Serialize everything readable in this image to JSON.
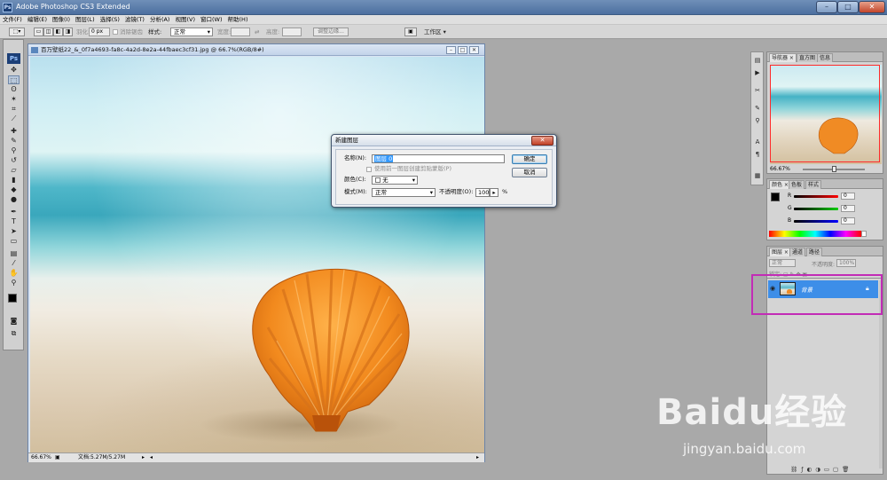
{
  "app": {
    "title": "Adobe Photoshop CS3 Extended",
    "logo": "Ps"
  },
  "window_controls": {
    "minimize": "–",
    "maximize": "□",
    "close": "✕"
  },
  "menu": [
    "文件(F)",
    "编辑(E)",
    "图像(I)",
    "图层(L)",
    "选择(S)",
    "滤镜(T)",
    "分析(A)",
    "视图(V)",
    "窗口(W)",
    "帮助(H)"
  ],
  "options": {
    "feather_label": "羽化:",
    "feather_value": "0 px",
    "antialias_label": "消除锯齿",
    "style_label": "样式:",
    "style_value": "正常",
    "width_label": "宽度:",
    "height_label": "高度:",
    "refine_edge": "调整边缘...",
    "workspace": "工作区 ▾"
  },
  "toolbox": {
    "logo": "Ps"
  },
  "document": {
    "title": "百万壁纸22_&_0f7a4693-fa8c-4a2d-8e2a-44fbaec3cf31.jpg @ 66.7%(RGB/8#)",
    "zoom": "66.67%",
    "docsize": "文档:5.27M/5.27M"
  },
  "dialog": {
    "title": "新建图层",
    "name_label": "名称(N):",
    "name_value": "图层 0",
    "clip_label": "使用前一图层创建剪贴蒙版(P)",
    "color_label": "颜色(C):",
    "color_value": "无",
    "mode_label": "模式(M):",
    "mode_value": "正常",
    "opacity_label": "不透明度(O):",
    "opacity_value": "100",
    "opacity_unit": "%",
    "ok": "确定",
    "cancel": "取消"
  },
  "navigator": {
    "tabs": [
      "导航器",
      "直方图",
      "信息"
    ],
    "zoom": "66.67%"
  },
  "color_panel": {
    "tabs": [
      "颜色",
      "色板",
      "样式"
    ],
    "r_label": "R",
    "g_label": "G",
    "b_label": "B",
    "r": "0",
    "g": "0",
    "b": "0"
  },
  "layers": {
    "tabs": [
      "图层",
      "通道",
      "路径"
    ],
    "blend": "正常",
    "opacity_label": "不透明度:",
    "opacity": "100%",
    "layer_name": "背景"
  },
  "watermark": {
    "brand": "Baidu经验",
    "url": "jingyan.baidu.com"
  }
}
